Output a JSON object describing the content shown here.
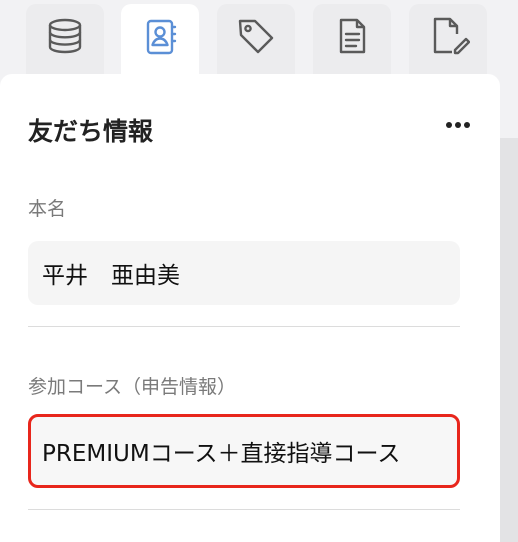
{
  "tabs": [
    {
      "icon": "database-icon",
      "active": false
    },
    {
      "icon": "contact-book-icon",
      "active": true
    },
    {
      "icon": "tag-icon",
      "active": false
    },
    {
      "icon": "document-icon",
      "active": false
    },
    {
      "icon": "edit-document-icon",
      "active": false
    }
  ],
  "colors": {
    "active_icon": "#5b8fd6",
    "inactive_icon": "#5a5a5a",
    "highlight_border": "#e8261c"
  },
  "panel": {
    "title": "友だち情報",
    "more_icon": "more-horizontal-icon"
  },
  "fields": {
    "real_name": {
      "label": "本名",
      "value": "平井　亜由美"
    },
    "course": {
      "label": "参加コース（申告情報）",
      "value": "PREMIUMコース＋直接指導コース"
    }
  }
}
